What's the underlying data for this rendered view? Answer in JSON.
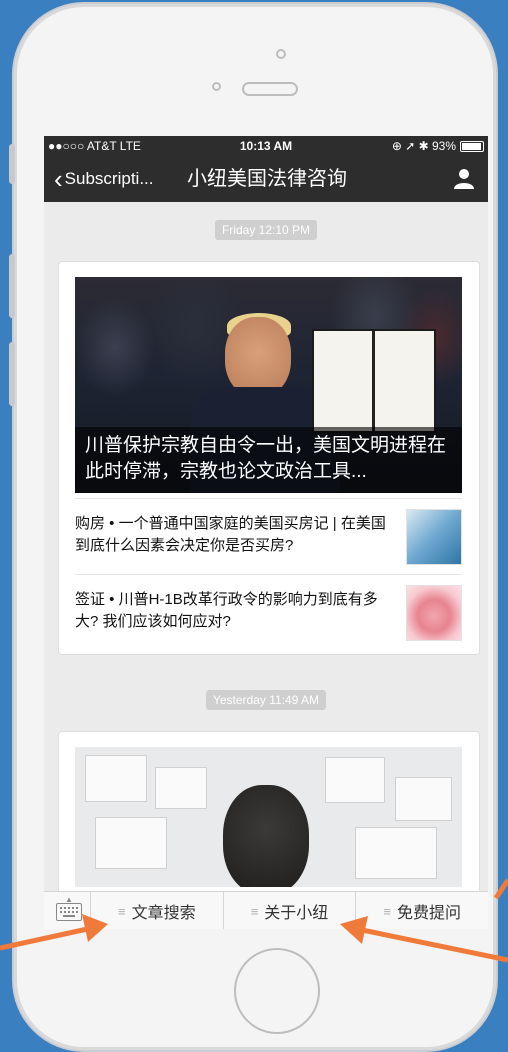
{
  "status_bar": {
    "carrier": "●●○○○ AT&T  LTE",
    "time": "10:13 AM",
    "right": "⊕ ➚ ✱ 93%"
  },
  "nav": {
    "back_label": "Subscripti...",
    "title": "小纽美国法律咨询"
  },
  "feed": [
    {
      "timestamp": "Friday 12:10 PM",
      "main_caption": "川普保护宗教自由令一出，美国文明进程在此时停滞，宗教也论文政治工具...",
      "items": [
        {
          "text": "购房 • 一个普通中国家庭的美国买房记 | 在美国到底什么因素会决定你是否买房?",
          "thumb": "building-thumbnail"
        },
        {
          "text": "签证 • 川普H-1B改革行政令的影响力到底有多大? 我们应该如何应对?",
          "thumb": "face-thumbnail"
        }
      ]
    },
    {
      "timestamp": "Yesterday 11:49 AM"
    }
  ],
  "menu": {
    "keyboard": "keyboard-icon",
    "items": [
      "文章搜索",
      "关于小纽",
      "免费提问"
    ],
    "lines_glyph": "≡"
  },
  "colors": {
    "background": "#3a7fc0",
    "navbar": "#2d2d2d",
    "arrow": "#f07a3a"
  }
}
